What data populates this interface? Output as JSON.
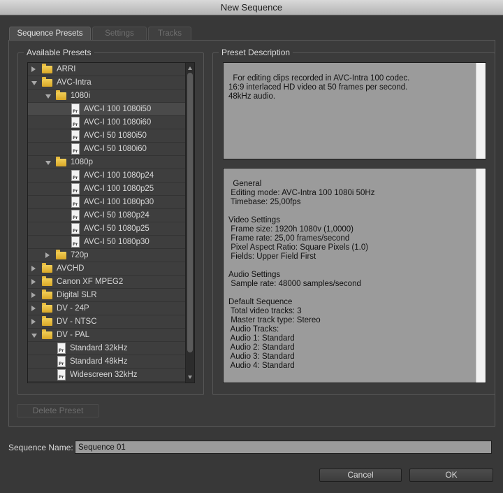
{
  "window": {
    "title": "New Sequence"
  },
  "tabs": [
    {
      "label": "Sequence Presets",
      "active": true
    },
    {
      "label": "Settings",
      "active": false
    },
    {
      "label": "Tracks",
      "active": false
    }
  ],
  "available_presets": {
    "title": "Available Presets",
    "items": [
      {
        "label": "ARRI",
        "type": "folder",
        "expanded": false,
        "level": 0,
        "selected": false
      },
      {
        "label": "AVC-Intra",
        "type": "folder",
        "expanded": true,
        "level": 0,
        "selected": false
      },
      {
        "label": "1080i",
        "type": "folder",
        "expanded": true,
        "level": 1,
        "selected": false
      },
      {
        "label": "AVC-I 100 1080i50",
        "type": "preset",
        "level": 2,
        "selected": true
      },
      {
        "label": "AVC-I 100 1080i60",
        "type": "preset",
        "level": 2,
        "selected": false
      },
      {
        "label": "AVC-I 50 1080i50",
        "type": "preset",
        "level": 2,
        "selected": false
      },
      {
        "label": "AVC-I 50 1080i60",
        "type": "preset",
        "level": 2,
        "selected": false
      },
      {
        "label": "1080p",
        "type": "folder",
        "expanded": true,
        "level": 1,
        "selected": false
      },
      {
        "label": "AVC-I 100 1080p24",
        "type": "preset",
        "level": 2,
        "selected": false
      },
      {
        "label": "AVC-I 100 1080p25",
        "type": "preset",
        "level": 2,
        "selected": false
      },
      {
        "label": "AVC-I 100 1080p30",
        "type": "preset",
        "level": 2,
        "selected": false
      },
      {
        "label": "AVC-I 50 1080p24",
        "type": "preset",
        "level": 2,
        "selected": false
      },
      {
        "label": "AVC-I 50 1080p25",
        "type": "preset",
        "level": 2,
        "selected": false
      },
      {
        "label": "AVC-I 50 1080p30",
        "type": "preset",
        "level": 2,
        "selected": false
      },
      {
        "label": "720p",
        "type": "folder",
        "expanded": false,
        "level": 1,
        "selected": false
      },
      {
        "label": "AVCHD",
        "type": "folder",
        "expanded": false,
        "level": 0,
        "selected": false
      },
      {
        "label": "Canon XF MPEG2",
        "type": "folder",
        "expanded": false,
        "level": 0,
        "selected": false
      },
      {
        "label": "Digital SLR",
        "type": "folder",
        "expanded": false,
        "level": 0,
        "selected": false
      },
      {
        "label": "DV - 24P",
        "type": "folder",
        "expanded": false,
        "level": 0,
        "selected": false
      },
      {
        "label": "DV - NTSC",
        "type": "folder",
        "expanded": false,
        "level": 0,
        "selected": false
      },
      {
        "label": "DV - PAL",
        "type": "folder",
        "expanded": true,
        "level": 0,
        "selected": false
      },
      {
        "label": "Standard 32kHz",
        "type": "preset",
        "level": 1,
        "selected": false
      },
      {
        "label": "Standard 48kHz",
        "type": "preset",
        "level": 1,
        "selected": false
      },
      {
        "label": "Widescreen 32kHz",
        "type": "preset",
        "level": 1,
        "selected": false
      }
    ]
  },
  "preset_description": {
    "title": "Preset Description",
    "summary": "For editing clips recorded in AVC-Intra 100 codec.\n16:9 interlaced HD video at 50 frames per second.\n48kHz audio.",
    "details": "General\n Editing mode: AVC-Intra 100 1080i 50Hz\n Timebase: 25,00fps\n\nVideo Settings\n Frame size: 1920h 1080v (1,0000)\n Frame rate: 25,00 frames/second\n Pixel Aspect Ratio: Square Pixels (1.0)\n Fields: Upper Field First\n\nAudio Settings\n Sample rate: 48000 samples/second\n\nDefault Sequence\n Total video tracks: 3\n Master track type: Stereo\n Audio Tracks:\n Audio 1: Standard\n Audio 2: Standard\n Audio 3: Standard\n Audio 4: Standard"
  },
  "buttons": {
    "delete_preset": "Delete Preset",
    "cancel": "Cancel",
    "ok": "OK"
  },
  "sequence_name": {
    "label": "Sequence Name:",
    "value": "Sequence 01"
  },
  "icons": {
    "folder": "folder-icon",
    "preset": "premiere-preset-file-icon",
    "expand": "disclosure-triangle-icon"
  }
}
